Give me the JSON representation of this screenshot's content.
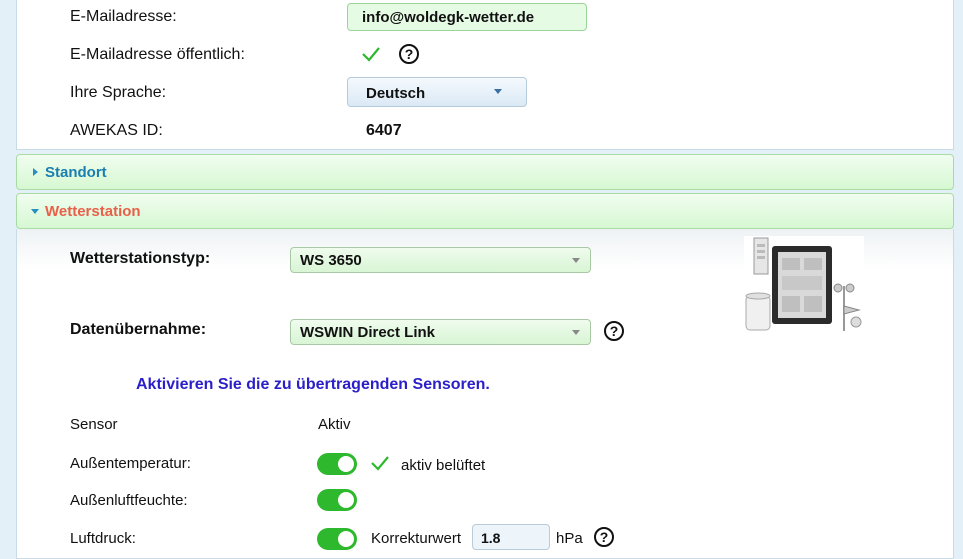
{
  "account": {
    "email_label": "E-Mailadresse:",
    "email_value": "info@woldegk-wetter.de",
    "email_public_label": "E-Mailadresse öffentlich:",
    "language_label": "Ihre Sprache:",
    "language_value": "Deutsch",
    "awekas_id_label": "AWEKAS ID:",
    "awekas_id_value": "6407",
    "help_glyph": "?"
  },
  "sections": {
    "standort": "Standort",
    "wetterstation": "Wetterstation"
  },
  "station": {
    "type_label": "Wetterstationstyp:",
    "type_value": "WS 3650",
    "import_label": "Datenübernahme:",
    "import_value": "WSWIN Direct Link",
    "notice": "Aktivieren Sie die zu übertragenden Sensoren."
  },
  "sensors": {
    "col_sensor": "Sensor",
    "col_active": "Aktiv",
    "rows": [
      {
        "label": "Außentemperatur:",
        "active": true,
        "extra": "aktiv belüftet"
      },
      {
        "label": "Außenluftfeuchte:",
        "active": true
      },
      {
        "label": "Luftdruck:",
        "active": true,
        "correction_label": "Korrekturwert",
        "correction_value": "1.8",
        "unit": "hPa"
      }
    ]
  },
  "colors": {
    "accordion_closed_title": "#1a7fb0",
    "accordion_open_title": "#e8604a",
    "toggle_on": "#2eb82e",
    "checkmark": "#2eb82e",
    "notice": "#2a1fc8"
  }
}
